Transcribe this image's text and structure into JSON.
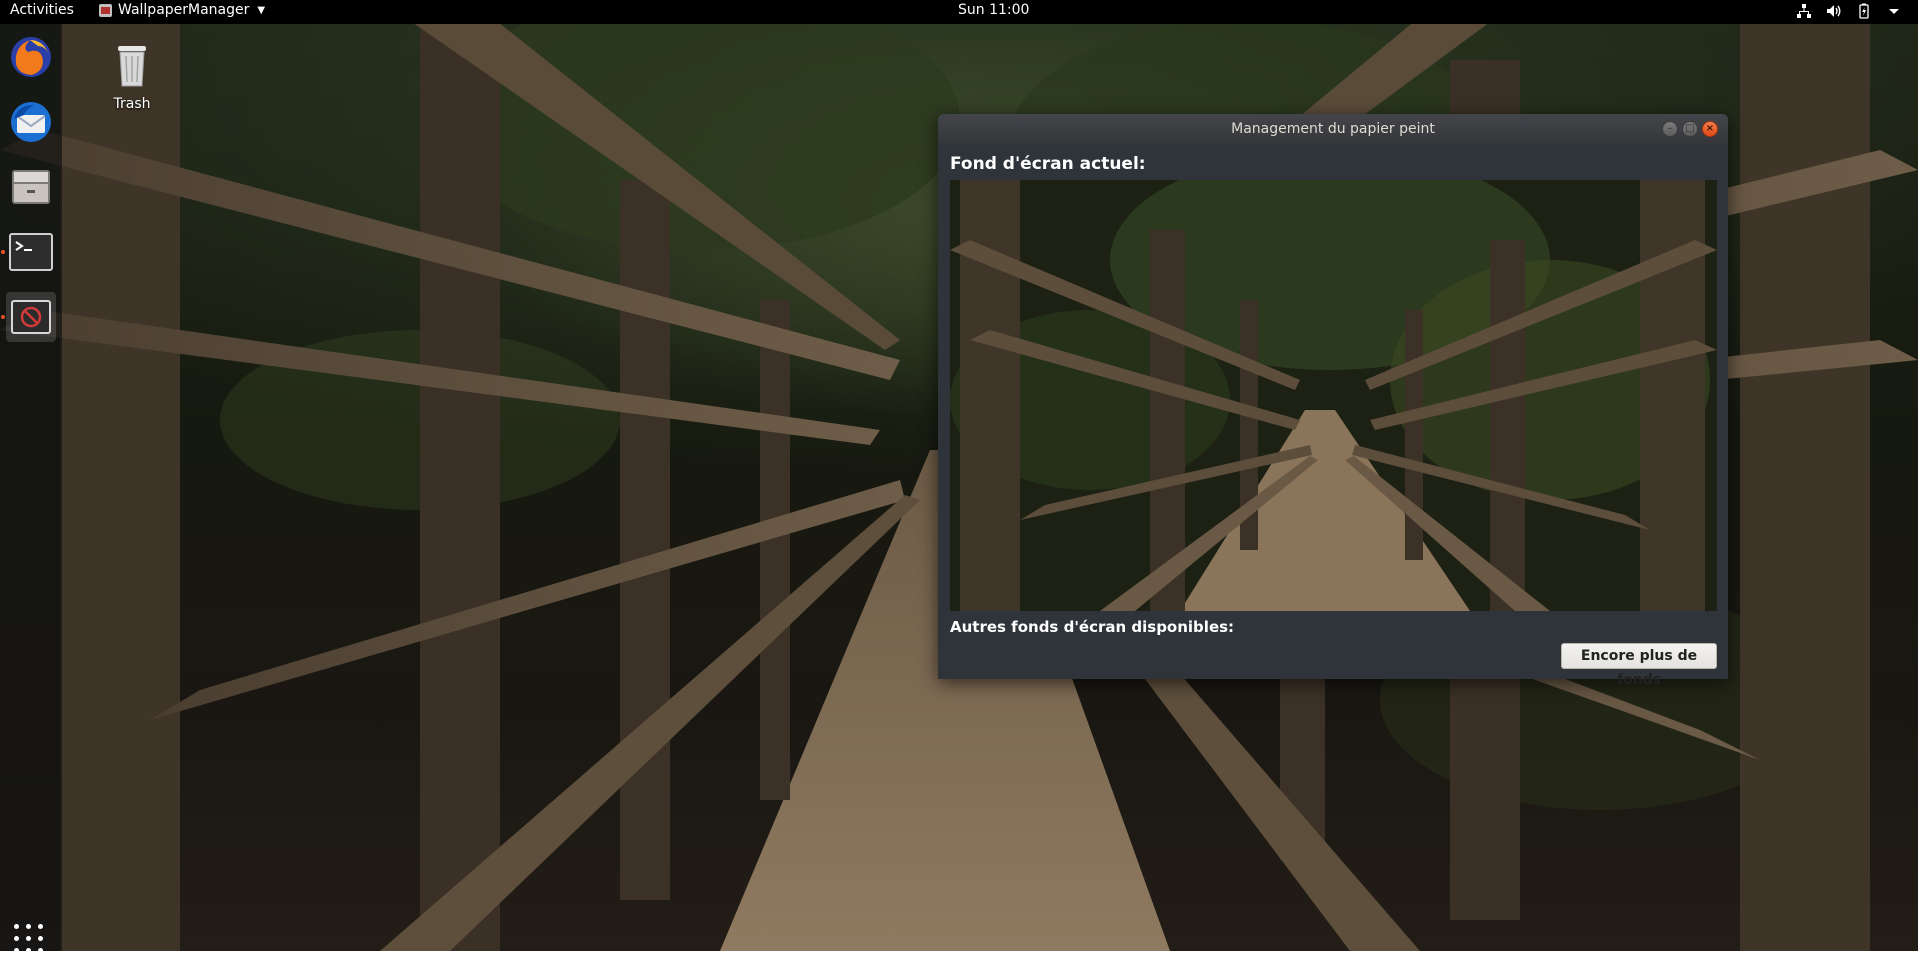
{
  "topbar": {
    "activities": "Activities",
    "app_menu": "WallpaperManager",
    "clock": "Sun 11:00",
    "tray_icons": [
      "network-icon",
      "volume-icon",
      "battery-icon",
      "system-menu-caret-icon"
    ]
  },
  "dock": {
    "apps": [
      "firefox",
      "thunderbird",
      "files",
      "terminal",
      "wallpaper-manager"
    ],
    "show_apps_icon": "apps-grid-icon"
  },
  "desktop": {
    "trash_label": "Trash"
  },
  "window": {
    "title": "Management du papier peint",
    "current_label": "Fond d'écran actuel:",
    "others_label": "Autres fonds d'écran disponibles:",
    "more_button": "Encore plus de fonds"
  },
  "colors": {
    "accent": "#e95420",
    "topbar": "#000000",
    "window_bg": "#2f343b"
  }
}
